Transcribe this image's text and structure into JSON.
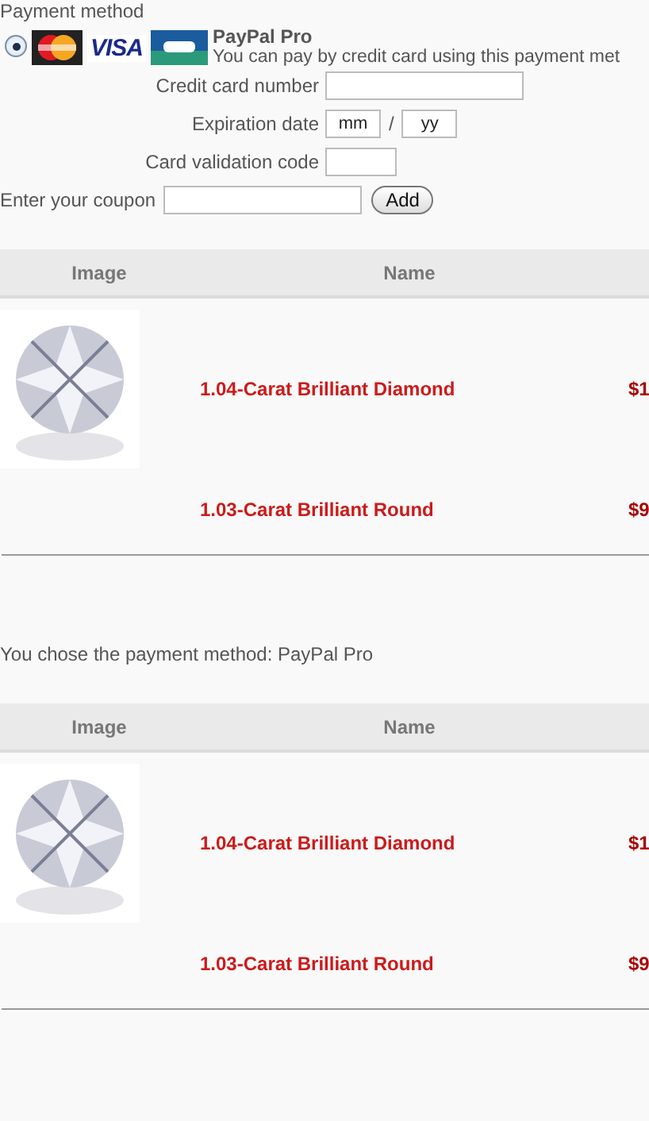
{
  "payment": {
    "heading": "Payment method",
    "options": [
      {
        "selected": true,
        "visa_logo": "VISA",
        "name": "PayPal Pro",
        "description": "You can pay by credit card using this payment met"
      }
    ],
    "fields": [
      {
        "kind": "text",
        "label": "Credit card number"
      },
      {
        "kind": "date",
        "label": "Expiration date",
        "month": {
          "placeholder": "mm"
        },
        "separator": "/",
        "year": {
          "placeholder": "yy"
        }
      },
      {
        "kind": "short",
        "label": "Card validation code"
      }
    ],
    "coupon": {
      "label": "Enter your coupon",
      "button": "Add"
    }
  },
  "cart_table": {
    "columns": [
      "Image",
      "Name"
    ],
    "rows": [
      {
        "kind": "image",
        "name": "1.04-Carat Brilliant Diamond",
        "price": "$1"
      },
      {
        "kind": "plain",
        "name": "1.03-Carat Brilliant Round",
        "price": "$9"
      }
    ]
  },
  "confirmation": "You chose the payment method: PayPal Pro",
  "summary_table": {
    "columns": [
      "Image",
      "Name"
    ],
    "rows": [
      {
        "kind": "image",
        "name": "1.04-Carat Brilliant Diamond",
        "price": "$1"
      },
      {
        "kind": "plain",
        "name": "1.03-Carat Brilliant Round",
        "price": "$9"
      }
    ]
  }
}
